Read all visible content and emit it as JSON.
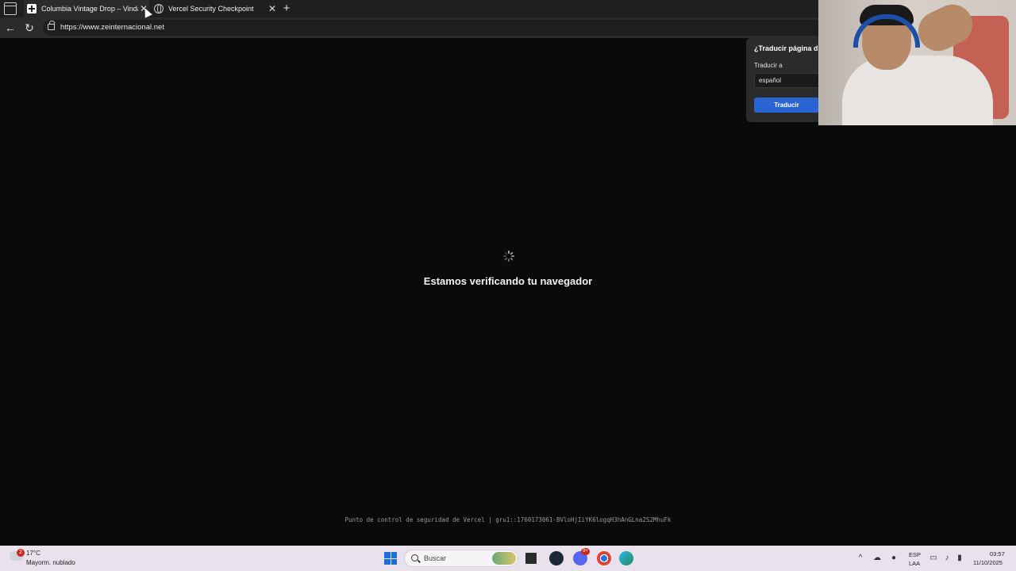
{
  "browser": {
    "tabs": [
      {
        "title": "Columbia Vintage Drop – Vindays",
        "close": "✕"
      },
      {
        "title": "Vercel Security Checkpoint",
        "close": "✕"
      }
    ],
    "new_tab": "+",
    "back": "←",
    "reload": "↻",
    "url": "https://www.zeinternacional.net"
  },
  "translate_popup": {
    "title": "¿Traducir página d",
    "label": "Traducir a",
    "language": "español",
    "button": "Traducir"
  },
  "page": {
    "heading": "Estamos verificando tu navegador",
    "footer": "Punto de control de seguridad de Vercel | gru1::1760173061-BVloHjIiYK6logqH3hAnGLna2S2MhuFk"
  },
  "taskbar": {
    "weather_badge": "2",
    "temperature": "17°C",
    "condition": "Mayorm. nublado",
    "search_placeholder": "Buscar",
    "discord_badge": "9+",
    "language_top": "ESP",
    "language_bottom": "LAA",
    "time": "03:57",
    "date": "11/10/2025"
  },
  "icons": [
    "tab-actions-icon",
    "plus-favicon",
    "globe-favicon",
    "close-icon",
    "back-icon",
    "reload-icon",
    "lock-icon",
    "spinner-icon",
    "windows-start-icon",
    "search-icon",
    "file-explorer-icon",
    "steam-icon",
    "discord-icon",
    "chrome-icon",
    "edge-icon",
    "chevron-up-icon",
    "onedrive-icon",
    "mic-icon",
    "volume-icon",
    "battery-icon"
  ]
}
